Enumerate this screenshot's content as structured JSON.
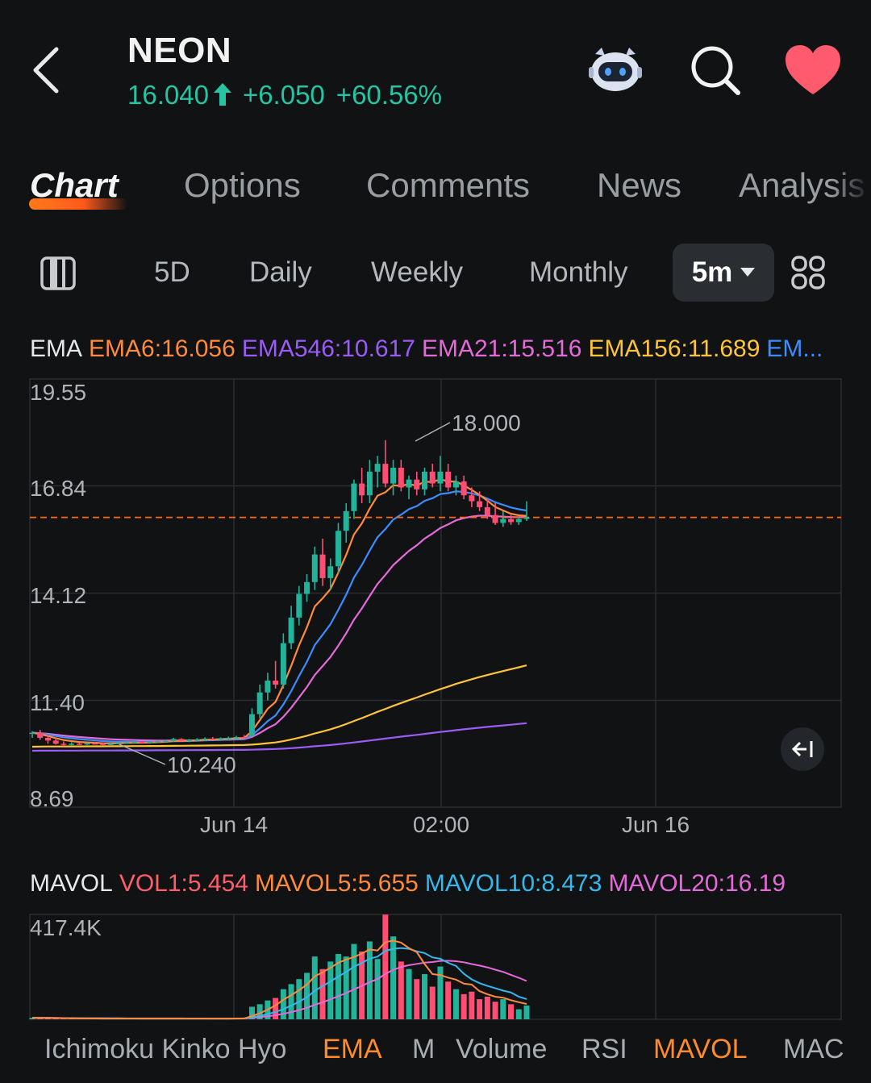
{
  "header": {
    "ticker": "NEON",
    "price": "16.040",
    "change": "+6.050",
    "change_pct": "+60.56%",
    "price_color": "#27c4a4",
    "icons": [
      "back-chevron-icon",
      "robot-assistant-icon",
      "search-icon",
      "heart-icon"
    ]
  },
  "tabs": [
    "Chart",
    "Options",
    "Comments",
    "News",
    "Analysis"
  ],
  "active_tab": "Chart",
  "periods": {
    "items": [
      "5D",
      "Daily",
      "Weekly",
      "Monthly"
    ],
    "selected": "5m"
  },
  "ema_legend": {
    "title": "EMA",
    "items": [
      {
        "text": "EMA6:16.056",
        "color": "#ff8a3c"
      },
      {
        "text": "EMA546:10.617",
        "color": "#9b5cf5"
      },
      {
        "text": "EMA21:15.516",
        "color": "#e56ad9"
      },
      {
        "text": "EMA156:11.689",
        "color": "#ffc43a"
      },
      {
        "text": "EM...",
        "color": "#3b8cff"
      }
    ]
  },
  "vol_legend": {
    "title": "MAVOL",
    "items": [
      {
        "text": "VOL1:5.454",
        "color": "#ff5c6c"
      },
      {
        "text": "MAVOL5:5.655",
        "color": "#ff8a3c"
      },
      {
        "text": "MAVOL10:8.473",
        "color": "#34b8ee"
      },
      {
        "text": "MAVOL20:16.19",
        "color": "#e56ad9"
      }
    ]
  },
  "bottom_indicators": [
    "Ichimoku Kinko Hyo",
    "EMA",
    "M",
    "Volume",
    "RSI",
    "MAVOL",
    "MAC"
  ],
  "chart_data": [
    {
      "type": "candlestick",
      "y_ticks": [
        "19.55",
        "16.84",
        "14.12",
        "11.40",
        "8.69"
      ],
      "ylim": [
        8.69,
        19.55
      ],
      "x_ticks": [
        "Jun 14",
        "02:00",
        "Jun 16"
      ],
      "annotations": [
        "18.000",
        "10.240"
      ],
      "last_price_line": 16.04,
      "high": 18.0,
      "low": 10.24,
      "candles": [
        [
          10.55,
          10.62,
          10.45,
          10.58
        ],
        [
          10.58,
          10.65,
          10.4,
          10.45
        ],
        [
          10.45,
          10.52,
          10.3,
          10.38
        ],
        [
          10.38,
          10.45,
          10.28,
          10.3
        ],
        [
          10.3,
          10.36,
          10.24,
          10.28
        ],
        [
          10.28,
          10.34,
          10.26,
          10.3
        ],
        [
          10.3,
          10.33,
          10.27,
          10.29
        ],
        [
          10.29,
          10.33,
          10.27,
          10.31
        ],
        [
          10.31,
          10.34,
          10.28,
          10.3
        ],
        [
          10.3,
          10.33,
          10.26,
          10.28
        ],
        [
          10.28,
          10.32,
          10.26,
          10.3
        ],
        [
          10.3,
          10.34,
          10.28,
          10.32
        ],
        [
          10.32,
          10.36,
          10.3,
          10.33
        ],
        [
          10.33,
          10.37,
          10.3,
          10.34
        ],
        [
          10.34,
          10.36,
          10.31,
          10.32
        ],
        [
          10.32,
          10.36,
          10.3,
          10.35
        ],
        [
          10.35,
          10.38,
          10.32,
          10.36
        ],
        [
          10.36,
          10.4,
          10.33,
          10.37
        ],
        [
          10.37,
          10.45,
          10.35,
          10.42
        ],
        [
          10.42,
          10.44,
          10.36,
          10.38
        ],
        [
          10.38,
          10.42,
          10.34,
          10.4
        ],
        [
          10.4,
          10.44,
          10.36,
          10.41
        ],
        [
          10.41,
          10.46,
          10.38,
          10.43
        ],
        [
          10.43,
          10.47,
          10.4,
          10.42
        ],
        [
          10.42,
          10.46,
          10.38,
          10.44
        ],
        [
          10.44,
          10.48,
          10.4,
          10.45
        ],
        [
          10.45,
          10.5,
          10.42,
          10.47
        ],
        [
          10.47,
          10.52,
          10.44,
          10.46
        ],
        [
          10.5,
          11.2,
          10.48,
          11.05
        ],
        [
          11.05,
          11.8,
          10.95,
          11.6
        ],
        [
          11.6,
          12.1,
          11.4,
          11.9
        ],
        [
          11.9,
          12.4,
          11.7,
          11.8
        ],
        [
          11.8,
          13.1,
          11.7,
          12.85
        ],
        [
          12.85,
          13.8,
          12.7,
          13.5
        ],
        [
          13.5,
          14.3,
          13.3,
          14.1
        ],
        [
          14.1,
          14.6,
          13.9,
          14.4
        ],
        [
          14.4,
          15.3,
          14.2,
          15.1
        ],
        [
          15.1,
          15.5,
          14.3,
          14.5
        ],
        [
          14.5,
          15.0,
          14.2,
          14.8
        ],
        [
          14.8,
          15.9,
          14.6,
          15.7
        ],
        [
          15.7,
          16.4,
          15.4,
          16.2
        ],
        [
          16.2,
          17.0,
          16.0,
          16.9
        ],
        [
          16.9,
          17.3,
          16.4,
          16.6
        ],
        [
          16.6,
          17.5,
          16.4,
          17.2
        ],
        [
          17.2,
          17.6,
          16.8,
          17.4
        ],
        [
          17.4,
          18.0,
          16.8,
          16.9
        ],
        [
          16.9,
          17.5,
          16.6,
          17.3
        ],
        [
          17.3,
          17.5,
          16.7,
          16.8
        ],
        [
          16.8,
          17.1,
          16.5,
          17.0
        ],
        [
          17.0,
          17.2,
          16.6,
          16.75
        ],
        [
          16.75,
          17.3,
          16.6,
          17.2
        ],
        [
          17.2,
          17.4,
          16.8,
          16.9
        ],
        [
          16.9,
          17.6,
          16.7,
          17.2
        ],
        [
          17.2,
          17.4,
          16.7,
          16.8
        ],
        [
          16.8,
          17.1,
          16.6,
          16.95
        ],
        [
          16.95,
          17.1,
          16.5,
          16.6
        ],
        [
          16.6,
          16.8,
          16.3,
          16.45
        ],
        [
          16.45,
          16.7,
          16.2,
          16.3
        ],
        [
          16.3,
          16.5,
          16.0,
          16.1
        ],
        [
          16.1,
          16.4,
          15.85,
          15.9
        ],
        [
          15.9,
          16.2,
          15.8,
          16.0
        ],
        [
          16.0,
          16.1,
          15.85,
          15.92
        ],
        [
          15.92,
          16.05,
          15.85,
          16.0
        ],
        [
          16.0,
          16.45,
          15.95,
          16.04
        ]
      ]
    },
    {
      "type": "bar",
      "title": "MAVOL",
      "y_ticks": [
        "417.4K"
      ],
      "ylim": [
        0,
        417.4
      ],
      "values": [
        6,
        5,
        5,
        4,
        4,
        3,
        3,
        3,
        3,
        3,
        3,
        3,
        3,
        3,
        3,
        3,
        3,
        3,
        3,
        3,
        3,
        3,
        3,
        3,
        3,
        3,
        4,
        4,
        50,
        60,
        75,
        85,
        120,
        140,
        160,
        185,
        250,
        200,
        230,
        260,
        250,
        300,
        270,
        310,
        240,
        417,
        330,
        230,
        200,
        160,
        180,
        130,
        210,
        150,
        120,
        100,
        110,
        80,
        90,
        70,
        80,
        60,
        40,
        55
      ]
    }
  ]
}
